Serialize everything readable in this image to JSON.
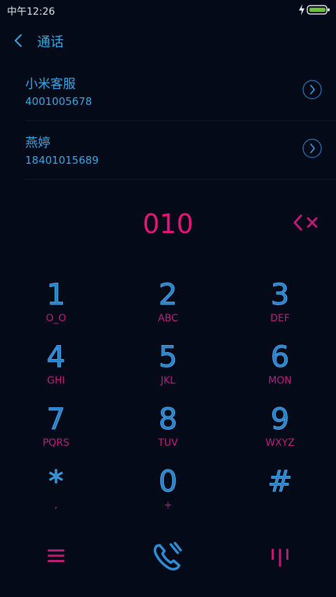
{
  "status_bar": {
    "time": "中午12:26"
  },
  "header": {
    "title": "通话"
  },
  "contacts": [
    {
      "name": "小米客服",
      "number": "4001005678"
    },
    {
      "name": "燕婷",
      "number": "18401015689"
    }
  ],
  "dialed": "010",
  "keys": [
    {
      "digit": "1",
      "letters": "O_O"
    },
    {
      "digit": "2",
      "letters": "ABC"
    },
    {
      "digit": "3",
      "letters": "DEF"
    },
    {
      "digit": "4",
      "letters": "GHI"
    },
    {
      "digit": "5",
      "letters": "JKL"
    },
    {
      "digit": "6",
      "letters": "MON"
    },
    {
      "digit": "7",
      "letters": "PQRS"
    },
    {
      "digit": "8",
      "letters": "TUV"
    },
    {
      "digit": "9",
      "letters": "WXYZ"
    },
    {
      "digit": "*",
      "letters": ","
    },
    {
      "digit": "0",
      "letters": "+"
    },
    {
      "digit": "#",
      "letters": ""
    }
  ],
  "colors": {
    "accent_blue": "#3ba7e6",
    "accent_pink": "#e6157a",
    "background": "#040a17"
  },
  "icons": {
    "back": "chevron-left-icon",
    "contact_arrow": "chevron-right-circle-icon",
    "backspace": "backspace-icon",
    "menu": "menu-icon",
    "call": "call-icon",
    "keypad_toggle": "keypad-toggle-icon"
  }
}
